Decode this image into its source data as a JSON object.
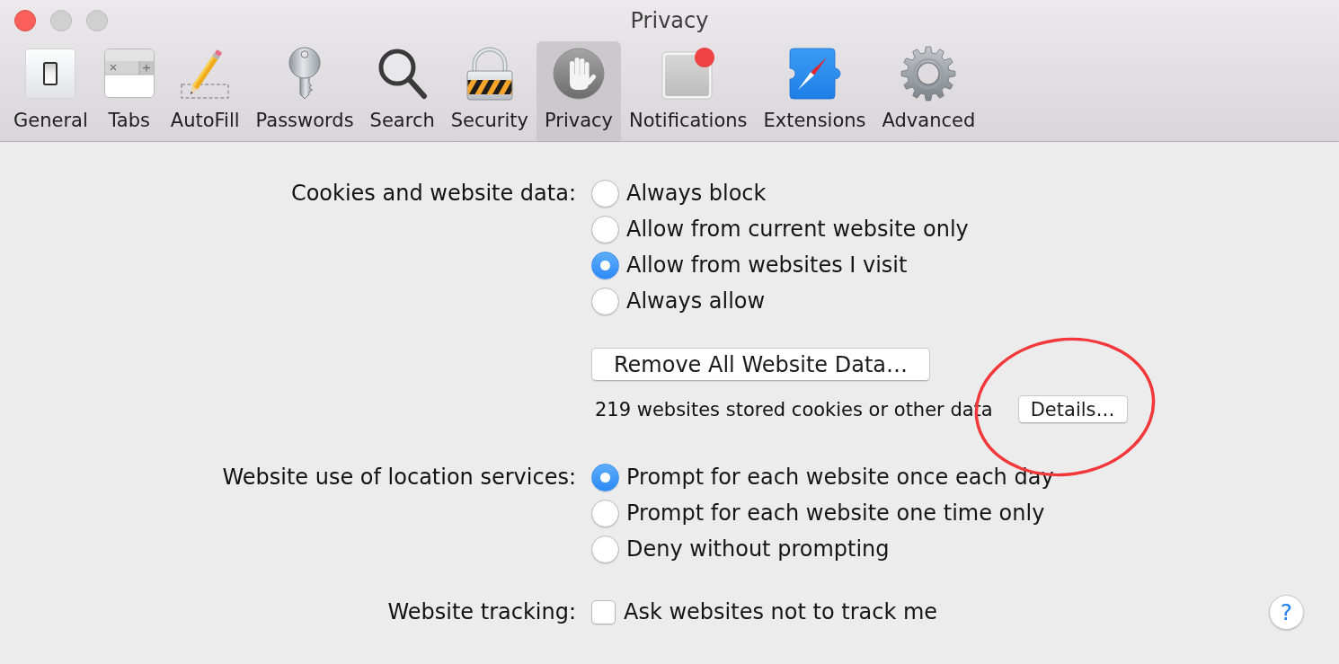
{
  "window": {
    "title": "Privacy"
  },
  "toolbar": {
    "items": [
      {
        "kind": "general",
        "label": "General",
        "selected": false
      },
      {
        "kind": "tabs",
        "label": "Tabs",
        "selected": false
      },
      {
        "kind": "autofill",
        "label": "AutoFill",
        "selected": false
      },
      {
        "kind": "passwords",
        "label": "Passwords",
        "selected": false
      },
      {
        "kind": "search",
        "label": "Search",
        "selected": false
      },
      {
        "kind": "security",
        "label": "Security",
        "selected": false
      },
      {
        "kind": "privacy",
        "label": "Privacy",
        "selected": true
      },
      {
        "kind": "notifications",
        "label": "Notifications",
        "selected": false
      },
      {
        "kind": "extensions",
        "label": "Extensions",
        "selected": false
      },
      {
        "kind": "advanced",
        "label": "Advanced",
        "selected": false
      }
    ]
  },
  "cookies": {
    "label": "Cookies and website data:",
    "options": [
      {
        "label": "Always block",
        "selected": false
      },
      {
        "label": "Allow from current website only",
        "selected": false
      },
      {
        "label": "Allow from websites I visit",
        "selected": true
      },
      {
        "label": "Always allow",
        "selected": false
      }
    ],
    "remove_button": "Remove All Website Data…",
    "stored_info": "219 websites stored cookies or other data",
    "details_button": "Details…"
  },
  "location": {
    "label": "Website use of location services:",
    "options": [
      {
        "label": "Prompt for each website once each day",
        "selected": true
      },
      {
        "label": "Prompt for each website one time only",
        "selected": false
      },
      {
        "label": "Deny without prompting",
        "selected": false
      }
    ]
  },
  "tracking": {
    "label": "Website tracking:",
    "checkbox": {
      "label": "Ask websites not to track me",
      "checked": false
    }
  },
  "help_button": "?"
}
